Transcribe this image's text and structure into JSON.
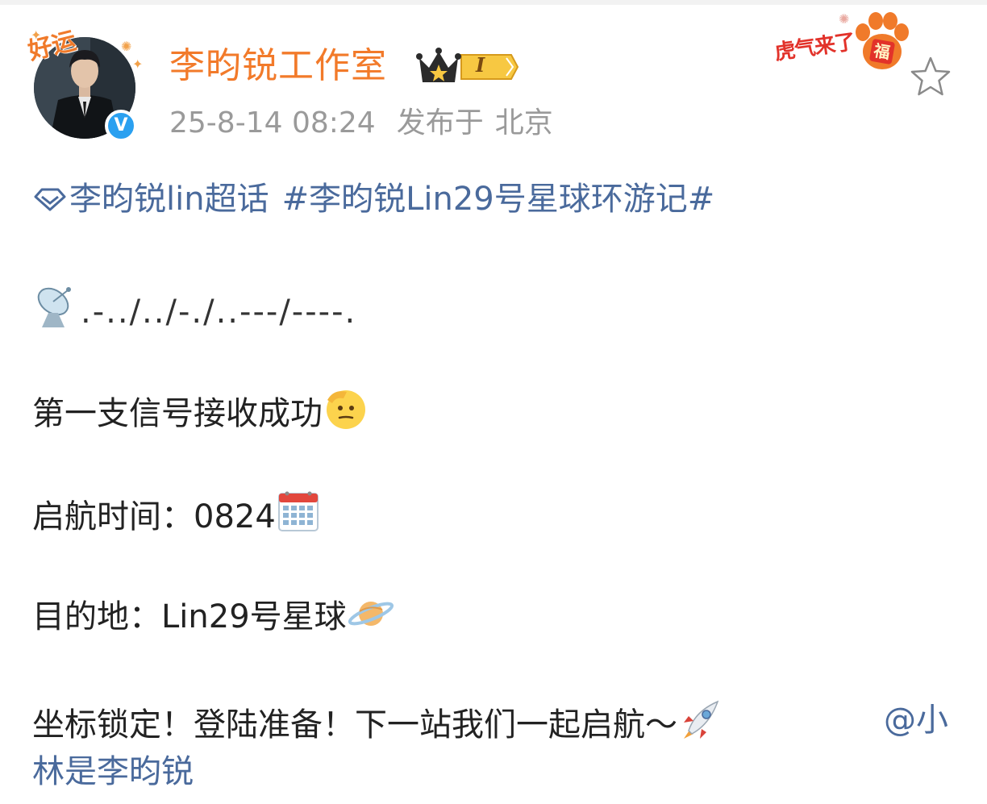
{
  "header": {
    "username": "李昀锐工作室",
    "level": "I",
    "timestamp": "25-8-14 08:24",
    "location_label": "发布于",
    "location": "北京",
    "avatar_frame_text": "好运",
    "decor_text": "虎气来了",
    "decor_stamp": "福",
    "verified_mark": "V"
  },
  "post": {
    "supertopic": "李昀锐lin超话",
    "hashtag": "#李昀锐Lin29号星球环游记#",
    "morse": ".-../../-./..---/----.",
    "line_signal": "第一支信号接收成功",
    "line_launch": "启航时间：0824",
    "line_destination": "目的地：Lin29号星球",
    "line_coords": "坐标锁定！登陆准备！下一站我们一起启航～",
    "mention": "@小林是李昀锐"
  },
  "icons": {
    "supertopic": "diamond-icon",
    "morse": "satellite-dish-icon",
    "signal": "saluting-face-icon",
    "launch": "calendar-icon",
    "destination": "ringed-planet-icon",
    "coords": "rocket-icon",
    "favorite": "star-outline-icon",
    "badge": "crown-icon"
  },
  "colors": {
    "username": "#f27a2a",
    "link": "#4a6a9c",
    "meta": "#9a9a9a",
    "text": "#222222",
    "verified": "#2aa0f0"
  }
}
